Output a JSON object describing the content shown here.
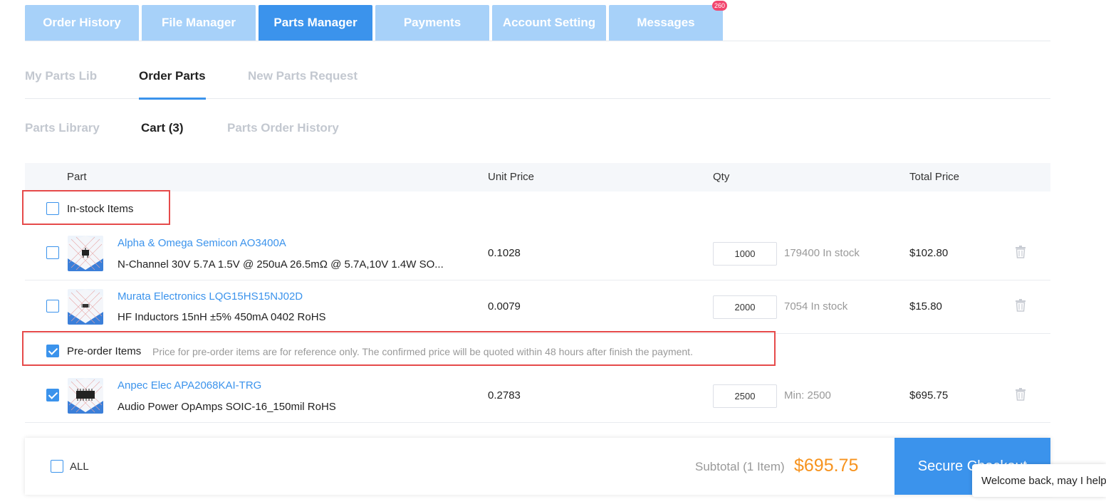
{
  "top_tabs": [
    {
      "label": "Order History"
    },
    {
      "label": "File Manager"
    },
    {
      "label": "Parts Manager"
    },
    {
      "label": "Payments"
    },
    {
      "label": "Account Setting"
    },
    {
      "label": "Messages",
      "badge": "260"
    }
  ],
  "sub_tabs": [
    {
      "label": "My Parts Lib"
    },
    {
      "label": "Order Parts"
    },
    {
      "label": "New Parts Request"
    }
  ],
  "third_tabs": [
    {
      "label": "Parts Library"
    },
    {
      "label": "Cart (3)"
    },
    {
      "label": "Parts Order History"
    }
  ],
  "table_header": {
    "part": "Part",
    "unit_price": "Unit Price",
    "qty": "Qty",
    "total_price": "Total Price"
  },
  "groups": {
    "in_stock": {
      "label": "In-stock Items",
      "checked": false
    },
    "pre_order": {
      "label": "Pre-order Items",
      "checked": true,
      "note": "Price for pre-order items are for reference only. The confirmed price will be quoted within 48 hours after finish the payment."
    }
  },
  "items": [
    {
      "name": "Alpha & Omega Semicon AO3400A",
      "desc": "N-Channel 30V 5.7A 1.5V @ 250uA 26.5mΩ @ 5.7A,10V 1.4W SO...",
      "unit_price": "0.1028",
      "qty": "1000",
      "stock": "179400 In stock",
      "total": "$102.80",
      "checked": false
    },
    {
      "name": "Murata Electronics LQG15HS15NJ02D",
      "desc": "HF Inductors 15nH ±5% 450mA 0402 RoHS",
      "unit_price": "0.0079",
      "qty": "2000",
      "stock": "7054 In stock",
      "total": "$15.80",
      "checked": false
    },
    {
      "name": "Anpec Elec APA2068KAI-TRG",
      "desc": "Audio Power OpAmps SOIC-16_150mil RoHS",
      "unit_price": "0.2783",
      "qty": "2500",
      "stock": "Min: 2500",
      "total": "$695.75",
      "checked": true
    }
  ],
  "footer": {
    "all_label": "ALL",
    "subtotal_label": "Subtotal (1 Item)",
    "subtotal_value": "$695.75",
    "checkout_label": "Secure Checkout"
  },
  "chat": {
    "text": "Welcome back, may I help"
  },
  "colors": {
    "accent": "#3b93ec",
    "tab_inactive": "#a7d1f9",
    "price": "#f7931e",
    "highlight": "#e64a4a"
  }
}
